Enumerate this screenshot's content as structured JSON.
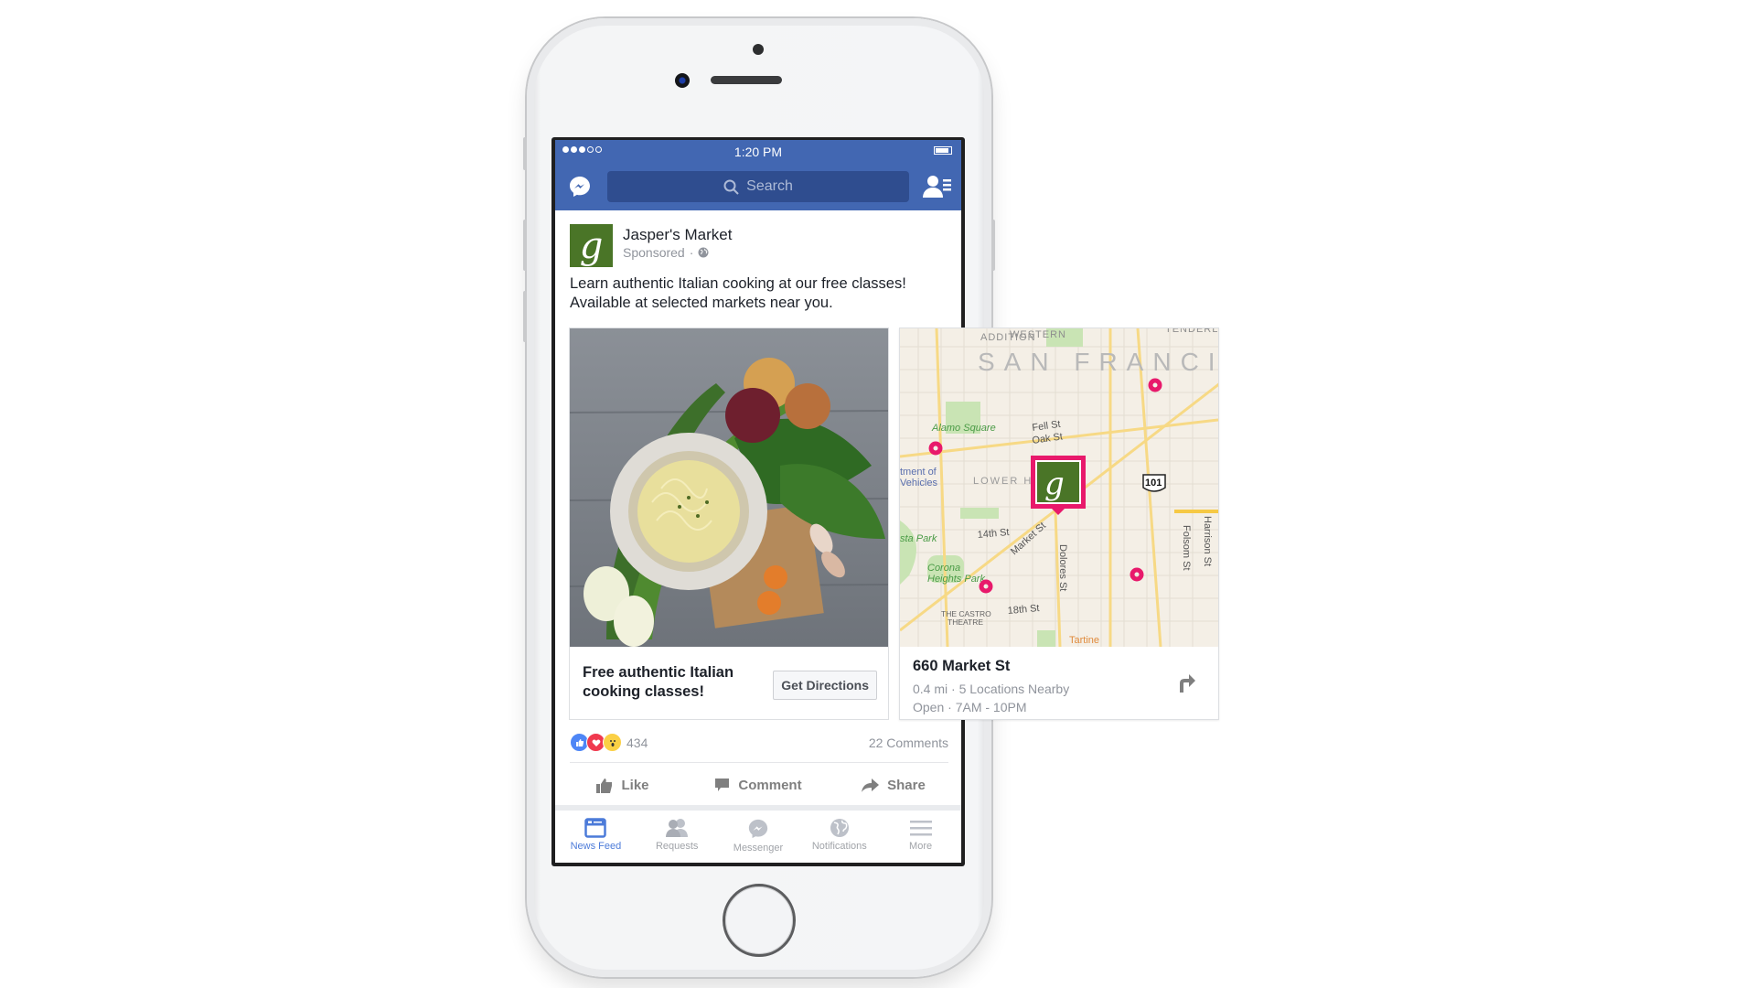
{
  "device": {
    "model": "iPhone",
    "color": "silver"
  },
  "status_bar": {
    "signal_bars_filled": 3,
    "signal_bars_total": 5,
    "time": "1:20 PM",
    "battery_level": 0.8
  },
  "nav_bar": {
    "messenger_icon": "messenger-icon",
    "search_placeholder": "Search",
    "friends_icon": "friend-requests-icon"
  },
  "post": {
    "page_name": "Jasper's Market",
    "page_logo_letter": "g",
    "sponsored_label": "Sponsored",
    "separator": "·",
    "audience_icon": "globe-icon",
    "text": "Learn authentic Italian cooking at our free classes! Available at selected markets near you.",
    "reactions": {
      "icons": [
        "like",
        "love",
        "wow"
      ],
      "count": "434"
    },
    "comments": "22 Comments",
    "actions": [
      {
        "label": "Like",
        "icon": "thumbs-up-icon"
      },
      {
        "label": "Comment",
        "icon": "comment-bubble-icon"
      },
      {
        "label": "Share",
        "icon": "share-arrow-icon"
      }
    ]
  },
  "carousel": {
    "cards": [
      {
        "image": "pasta bowl with vegetables",
        "headline": "Free authentic Italian cooking classes!",
        "cta_label": "Get Directions"
      },
      {
        "map": {
          "city_label": "SAN FRANCI",
          "district_labels": [
            "WESTERN ADDITION",
            "TENDERLOIN",
            "LOWER H"
          ],
          "street_labels": [
            "Fell St",
            "Oak St",
            "14th St",
            "Market St",
            "Dolores St",
            "18th St",
            "Folsom St",
            "Harrison St"
          ],
          "poi_labels": [
            "Alamo Square",
            "Corona Heights Park",
            "THE CASTRO THEATRE",
            "Tartine",
            "tment of Vehicles",
            "sta Park"
          ],
          "highway": "101",
          "accent_color": "#e8196b"
        },
        "address": "660 Market St",
        "distance_line": "0.4 mi · 5 Locations Nearby",
        "hours_line": "Open · 7AM - 10PM",
        "directions_icon": "turn-right-arrow-icon"
      }
    ]
  },
  "tab_bar": {
    "tabs": [
      {
        "label": "News Feed",
        "icon": "news-feed-icon",
        "active": true
      },
      {
        "label": "Requests",
        "icon": "friend-requests-icon",
        "active": false
      },
      {
        "label": "Messenger",
        "icon": "messenger-icon",
        "active": false
      },
      {
        "label": "Notifications",
        "icon": "globe-notifications-icon",
        "active": false
      },
      {
        "label": "More",
        "icon": "hamburger-menu-icon",
        "active": false
      }
    ]
  },
  "colors": {
    "facebook_blue": "#4267b2",
    "search_bg": "#2f4d8f",
    "brand_green": "#4a7527",
    "map_pin": "#e8196b",
    "active_tab": "#4c7bd9"
  }
}
